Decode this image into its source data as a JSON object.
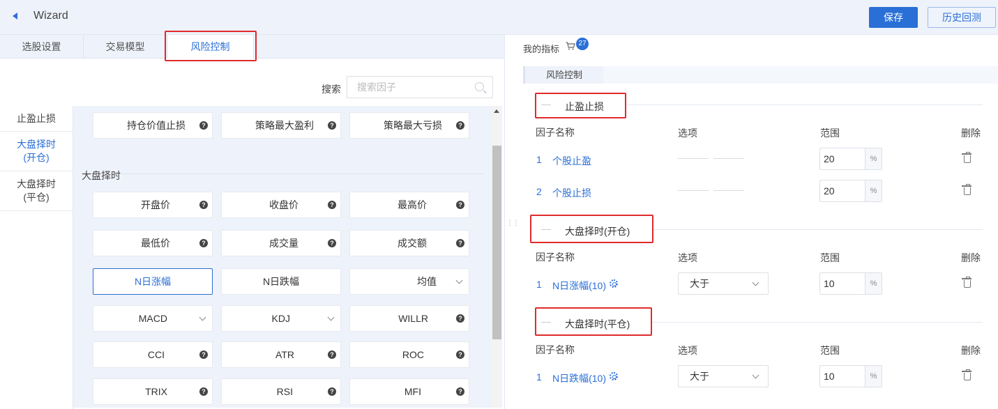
{
  "header": {
    "title": "Wizard",
    "save_label": "保存",
    "backtest_label": "历史回测"
  },
  "tabs": [
    {
      "label": "选股设置"
    },
    {
      "label": "交易模型"
    },
    {
      "label": "风险控制",
      "active": true
    }
  ],
  "search": {
    "label": "搜索",
    "placeholder": "搜索因子",
    "value": ""
  },
  "sidebar": {
    "items": [
      {
        "label": "止盈止损"
      },
      {
        "label_line1": "大盘择时",
        "label_line2": "(开仓)",
        "active": true
      },
      {
        "label_line1": "大盘择时",
        "label_line2": "(平仓)"
      }
    ]
  },
  "factor_groups": {
    "top_row": [
      "持仓价值止损",
      "策略最大盈利",
      "策略最大亏损"
    ],
    "market_timing": {
      "title": "大盘择时",
      "items": [
        {
          "label": "开盘价",
          "icon": "help"
        },
        {
          "label": "收盘价",
          "icon": "help"
        },
        {
          "label": "最高价",
          "icon": "help"
        },
        {
          "label": "最低价",
          "icon": "help"
        },
        {
          "label": "成交量",
          "icon": "help"
        },
        {
          "label": "成交额",
          "icon": "help"
        },
        {
          "label": "N日涨幅",
          "icon": "none",
          "selected": true
        },
        {
          "label": "N日跌幅",
          "icon": "none"
        },
        {
          "label": "均值",
          "icon": "chevron-down"
        },
        {
          "label": "MACD",
          "icon": "chevron-down"
        },
        {
          "label": "KDJ",
          "icon": "chevron-down"
        },
        {
          "label": "WILLR",
          "icon": "help"
        },
        {
          "label": "CCI",
          "icon": "help"
        },
        {
          "label": "ATR",
          "icon": "help"
        },
        {
          "label": "ROC",
          "icon": "help"
        },
        {
          "label": "TRIX",
          "icon": "help"
        },
        {
          "label": "RSI",
          "icon": "help"
        },
        {
          "label": "MFI",
          "icon": "help"
        }
      ]
    },
    "help_glyph": "?"
  },
  "right_panel": {
    "my_indicators_label": "我的指标",
    "cart_count": "27",
    "section_tab": "风险控制",
    "columns": {
      "name": "因子名称",
      "option": "选项",
      "range": "范围",
      "delete": "删除"
    },
    "sections": [
      {
        "title": "止盈止损",
        "rows": [
          {
            "index": "1",
            "name": "个股止盈",
            "option": "",
            "range": "20",
            "unit": "%"
          },
          {
            "index": "2",
            "name": "个股止损",
            "option": "",
            "range": "20",
            "unit": "%"
          }
        ]
      },
      {
        "title": "大盘择时(开仓)",
        "rows": [
          {
            "index": "1",
            "name": "N日涨幅(10)",
            "option": "大于",
            "range": "10",
            "unit": "%"
          }
        ]
      },
      {
        "title": "大盘择时(平仓)",
        "rows": [
          {
            "index": "1",
            "name": "N日跌幅(10)",
            "option": "大于",
            "range": "10",
            "unit": "%"
          }
        ]
      }
    ]
  },
  "colors": {
    "accent": "#2a6fd6",
    "highlight_box": "#e02a2a",
    "panel_bg": "#eef2fa"
  }
}
